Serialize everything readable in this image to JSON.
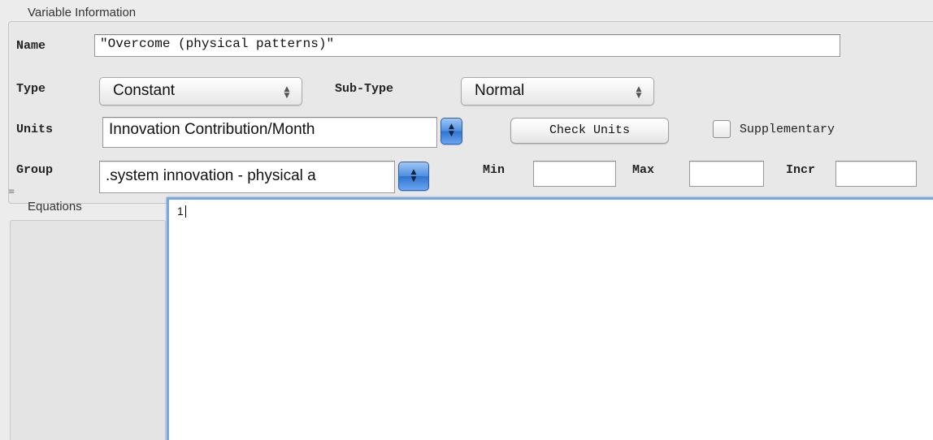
{
  "variable_information": {
    "title": "Variable Information",
    "name": {
      "label": "Name",
      "value": "\"Overcome (physical patterns)\""
    },
    "type": {
      "label": "Type",
      "selected": "Constant"
    },
    "sub_type": {
      "label": "Sub-Type",
      "selected": "Normal"
    },
    "units": {
      "label": "Units",
      "value": "Innovation Contribution/Month",
      "check_button": "Check Units"
    },
    "supplementary": {
      "label": "Supplementary",
      "checked": false
    },
    "group": {
      "label": "Group",
      "value": ".system innovation - physical a"
    },
    "min": {
      "label": "Min",
      "value": ""
    },
    "max": {
      "label": "Max",
      "value": ""
    },
    "incr": {
      "label": "Incr",
      "value": ""
    }
  },
  "equations": {
    "title": "Equations",
    "text": "1"
  },
  "icons": {
    "popup_arrows": "up-down-arrows-icon",
    "stepper": "blue-stepper-icon",
    "grip": "splitter-grip-icon"
  },
  "colors": {
    "focus_ring": "#7aa7dd",
    "stepper_blue": "#4d8fe0"
  }
}
